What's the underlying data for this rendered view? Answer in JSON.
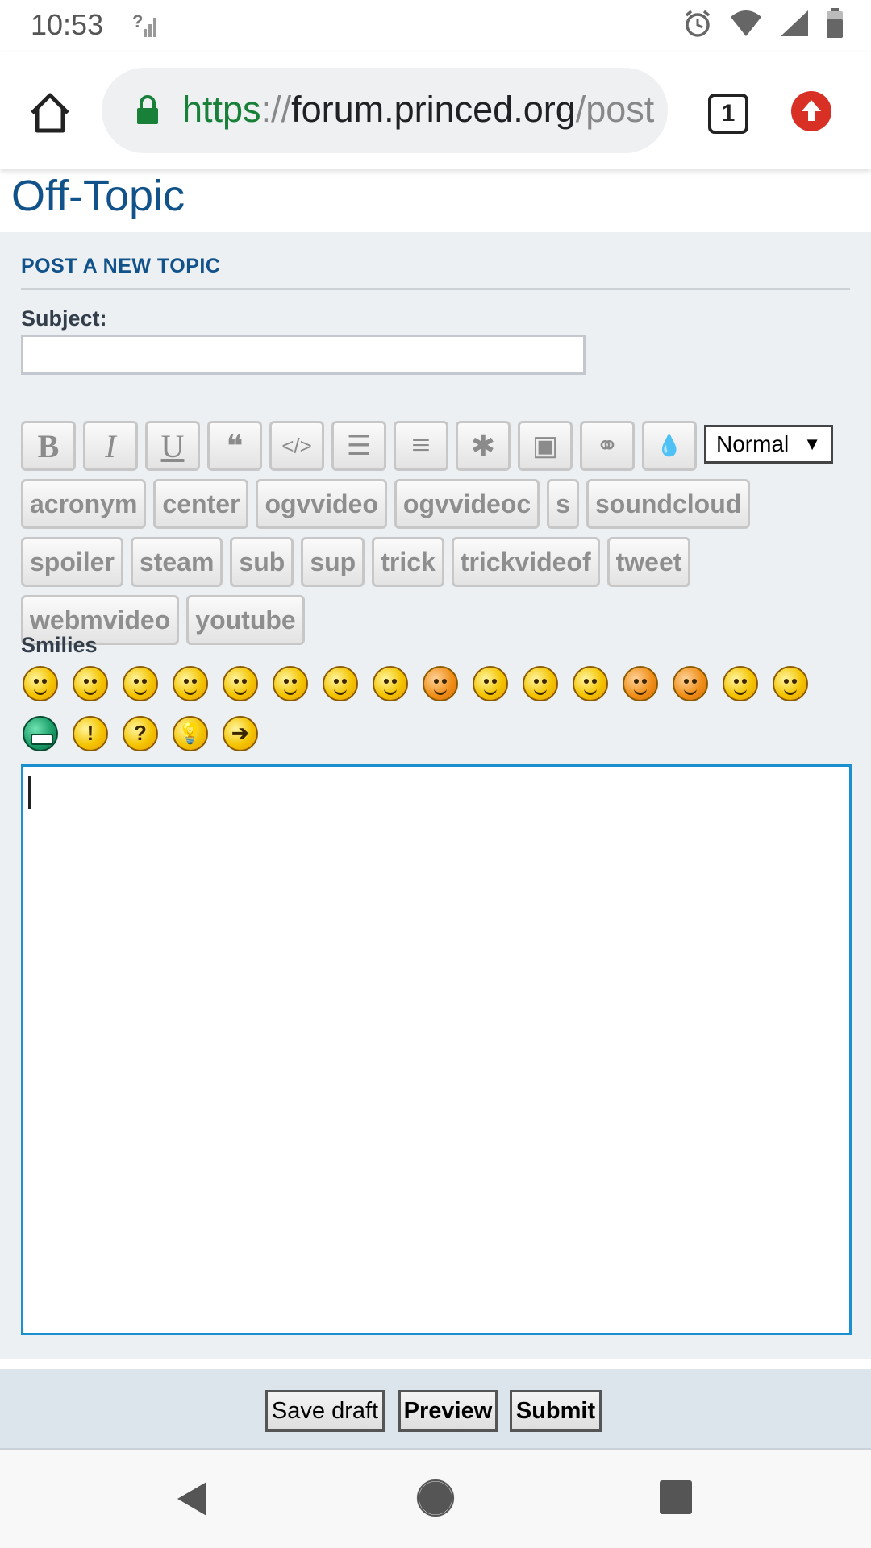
{
  "status_bar": {
    "time": "10:53",
    "icons": [
      "no-sim-signal-icon",
      "alarm-icon",
      "wifi-icon",
      "cell-signal-icon",
      "battery-icon"
    ]
  },
  "browser": {
    "url_scheme": "https",
    "url_separator": "://",
    "url_host": "forum.princed.org",
    "url_path": "/post",
    "tab_count": "1",
    "icons": [
      "home-icon",
      "lock-icon",
      "tabs-icon",
      "update-icon"
    ],
    "accent_colors": {
      "secure": "#188038",
      "update": "#d93025"
    }
  },
  "page": {
    "title": "Off-Topic",
    "section_title": "POST A NEW TOPIC",
    "subject_label": "Subject:",
    "subject_value": ""
  },
  "toolbar": {
    "icon_buttons": [
      {
        "name": "bold-button",
        "glyph": "B"
      },
      {
        "name": "italic-button",
        "glyph": "I"
      },
      {
        "name": "underline-button",
        "glyph": "U"
      },
      {
        "name": "quote-button",
        "glyph": "❝"
      },
      {
        "name": "code-button",
        "glyph": "</>"
      },
      {
        "name": "list-button",
        "glyph": "☰"
      },
      {
        "name": "ordered-list-button",
        "glyph": "≡"
      },
      {
        "name": "list-item-button",
        "glyph": "✱"
      },
      {
        "name": "image-button",
        "glyph": "▣"
      },
      {
        "name": "link-button",
        "glyph": "⚭"
      },
      {
        "name": "color-button",
        "glyph": "💧"
      }
    ],
    "font_size_selected": "Normal",
    "font_size_arrow": "▼",
    "tag_buttons": [
      "acronym",
      "center",
      "ogvvideo",
      "ogvvideoc",
      "s",
      "soundcloud",
      "spoiler",
      "steam",
      "sub",
      "sup",
      "trick",
      "trickvideof",
      "tweet",
      "webmvideo",
      "youtube"
    ]
  },
  "smilies": {
    "label": "Smilies",
    "row1": [
      {
        "name": "very-happy-smiley-icon",
        "style": "yellow"
      },
      {
        "name": "grin-smiley-icon",
        "style": "yellow"
      },
      {
        "name": "wink-smiley-icon",
        "style": "yellow"
      },
      {
        "name": "tongue-smiley-icon",
        "style": "yellow"
      },
      {
        "name": "laughing-smiley-icon",
        "style": "yellow"
      },
      {
        "name": "shocked-smiley-icon",
        "style": "yellow"
      },
      {
        "name": "rolling-eyes-smiley-icon",
        "style": "yellow"
      },
      {
        "name": "cool-smiley-icon",
        "style": "yellow"
      },
      {
        "name": "embarrassed-smiley-icon",
        "style": "orange"
      },
      {
        "name": "sad-smiley-icon",
        "style": "yellow"
      },
      {
        "name": "crying-smiley-icon",
        "style": "yellow"
      },
      {
        "name": "angry-smiley-icon",
        "style": "yellow"
      },
      {
        "name": "evil-smiley-icon",
        "style": "orange"
      },
      {
        "name": "twisted-evil-smiley-icon",
        "style": "orange"
      },
      {
        "name": "confused-smiley-icon",
        "style": "yellow"
      },
      {
        "name": "neutral-smiley-icon",
        "style": "yellow"
      }
    ],
    "row2": [
      {
        "name": "green-grin-smiley-icon",
        "style": "green",
        "sym": ""
      },
      {
        "name": "exclamation-smiley-icon",
        "style": "yellow",
        "sym": "!"
      },
      {
        "name": "question-smiley-icon",
        "style": "yellow",
        "sym": "?"
      },
      {
        "name": "idea-smiley-icon",
        "style": "yellow",
        "sym": "💡"
      },
      {
        "name": "arrow-smiley-icon",
        "style": "yellow",
        "sym": "➔"
      }
    ]
  },
  "editor": {
    "message_value": ""
  },
  "actions": {
    "save_draft": "Save draft",
    "preview": "Preview",
    "submit": "Submit"
  },
  "nav": {
    "icons": [
      "back-icon",
      "home-circle-icon",
      "recents-icon"
    ]
  }
}
